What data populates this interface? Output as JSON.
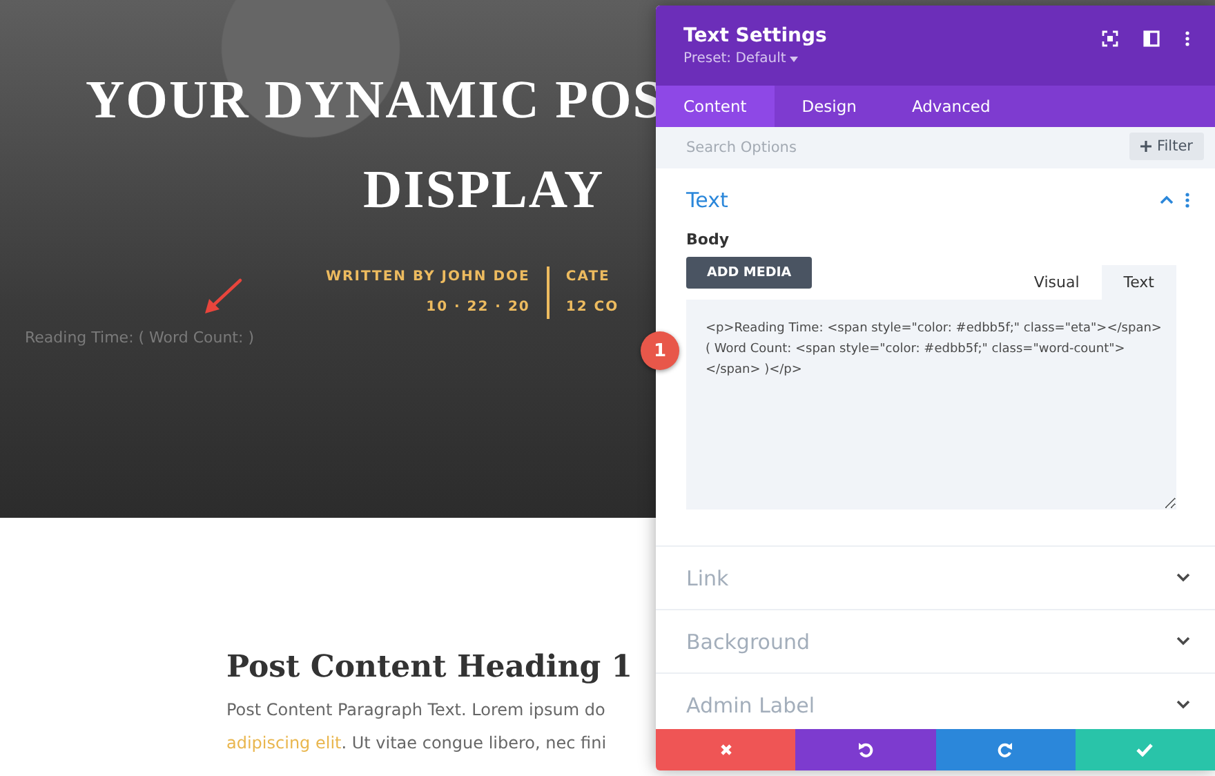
{
  "page": {
    "title_lines": [
      "YOUR DYNAMIC POS",
      "DISPLAY"
    ],
    "meta_left": [
      "WRITTEN BY JOHN DOE",
      "10 · 22 · 20"
    ],
    "meta_right": [
      "CATE",
      "12 CO"
    ],
    "reading_line": "Reading Time: ( Word Count: )",
    "heading": "Post Content Heading 1",
    "paragraph": {
      "line_1": "Post Content Paragraph Text. Lorem ipsum do",
      "link": "adipiscing elit",
      "line_2_rest": ". Ut vitae congue libero, nec fini"
    }
  },
  "callout": {
    "number": "1"
  },
  "panel": {
    "title": "Text Settings",
    "preset": "Preset: Default",
    "tabs": [
      {
        "label": "Content",
        "selected": true
      },
      {
        "label": "Design",
        "selected": false
      },
      {
        "label": "Advanced",
        "selected": false
      }
    ],
    "search": {
      "placeholder": "Search Options"
    },
    "filter": "Filter",
    "sections": [
      {
        "title": "Text",
        "expanded": true
      },
      {
        "title": "Link",
        "expanded": false
      },
      {
        "title": "Background",
        "expanded": false
      },
      {
        "title": "Admin Label",
        "expanded": false
      }
    ],
    "body_label": "Body",
    "add_media": "ADD MEDIA",
    "editor_tabs": [
      {
        "label": "Visual",
        "selected": false
      },
      {
        "label": "Text",
        "selected": true
      }
    ],
    "code": "<p>Reading Time: <span style=\"color: #edbb5f;\" class=\"eta\"></span>\n( Word Count: <span style=\"color: #edbb5f;\" class=\"word-count\">\n</span> )</p>",
    "footer": [
      {
        "kind": "cancel"
      },
      {
        "kind": "undo"
      },
      {
        "kind": "redo"
      },
      {
        "kind": "save"
      }
    ]
  }
}
